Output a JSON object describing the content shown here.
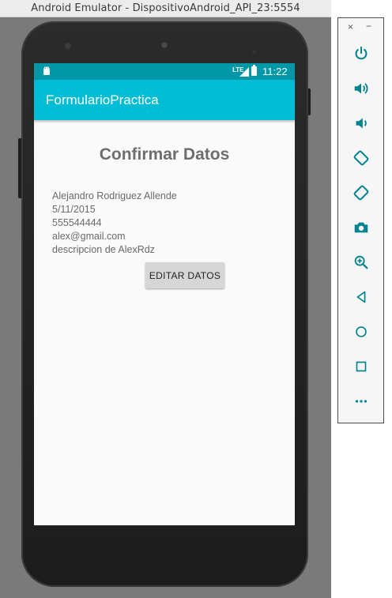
{
  "window": {
    "title": "Android Emulator - DispositivoAndroid_API_23:5554"
  },
  "statusbar": {
    "network": "LTE",
    "time": "11:22"
  },
  "appbar": {
    "title": "FormularioPractica"
  },
  "screen": {
    "heading": "Confirmar Datos",
    "details": [
      "Alejandro Rodriguez Allende",
      "5/11/2015",
      "555544444",
      "alex@gmail.com",
      "descripcion de AlexRdz"
    ],
    "edit_button": "EDITAR DATOS"
  },
  "toolbar": {
    "close": "×",
    "minimize": "−",
    "buttons": [
      "power-icon",
      "volume-up-icon",
      "volume-down-icon",
      "rotate-left-icon",
      "rotate-right-icon",
      "camera-icon",
      "zoom-icon",
      "back-icon",
      "home-icon",
      "overview-icon",
      "more-icon"
    ]
  },
  "colors": {
    "statusbar": "#0097a7",
    "appbar": "#00bcd4",
    "toolbar_icon": "#00838f"
  }
}
